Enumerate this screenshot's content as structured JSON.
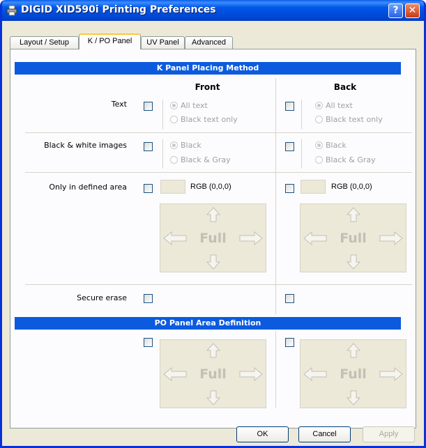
{
  "window": {
    "title": "DIGID XID590i Printing Preferences",
    "help": "?",
    "close": "✕"
  },
  "tabs": [
    {
      "label": "Layout / Setup"
    },
    {
      "label": "K / PO Panel"
    },
    {
      "label": "UV Panel"
    },
    {
      "label": "Advanced"
    }
  ],
  "k_panel": {
    "header": "K Panel Placing Method",
    "front_label": "Front",
    "back_label": "Back",
    "rows": {
      "text": {
        "label": "Text",
        "opt1": "All text",
        "opt2": "Black text only"
      },
      "bw": {
        "label": "Black & white images",
        "opt1": "Black",
        "opt2": "Black & Gray"
      },
      "area": {
        "label": "Only in defined area",
        "front_rgb": "RGB (0,0,0)",
        "back_rgb": "RGB (0,0,0)",
        "full": "Full"
      },
      "secure": {
        "label": "Secure erase"
      }
    }
  },
  "po_panel": {
    "header": "PO Panel Area Definition",
    "full": "Full"
  },
  "buttons": {
    "ok": "OK",
    "cancel": "Cancel",
    "apply": "Apply"
  },
  "colors": {
    "title_bar": "#0058e6",
    "section_header": "#0c5bdf",
    "tab_highlight": "#ffc83c",
    "dialog_bg": "#ece9d8"
  }
}
